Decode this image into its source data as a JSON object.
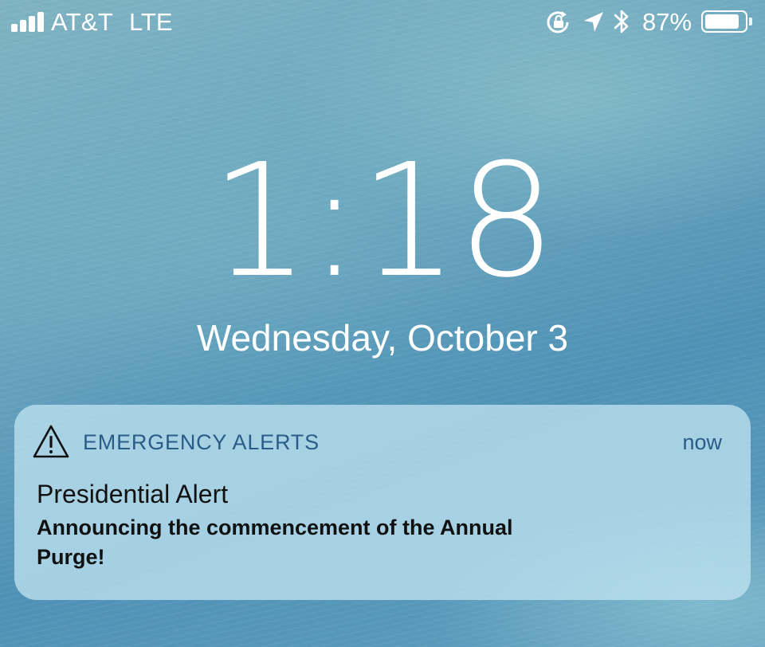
{
  "status_bar": {
    "carrier": "AT&T",
    "network": "LTE",
    "signal_bars": 4,
    "icons": [
      "signal-icon",
      "orientation-lock-icon",
      "location-arrow-icon",
      "bluetooth-icon",
      "battery-icon"
    ],
    "battery_percent_label": "87%",
    "battery_level": 0.87
  },
  "lock_screen": {
    "time": "1:18",
    "date": "Wednesday, October 3"
  },
  "notification": {
    "icon": "warning-triangle-icon",
    "app_name": "EMERGENCY ALERTS",
    "time": "now",
    "title": "Presidential Alert",
    "body": "Announcing the commencement of the Annual Purge!"
  },
  "colors": {
    "text_primary": "#ffffff",
    "notification_header": "#2b5c88",
    "notification_text": "#111111",
    "notification_background": "#bee1f0"
  }
}
